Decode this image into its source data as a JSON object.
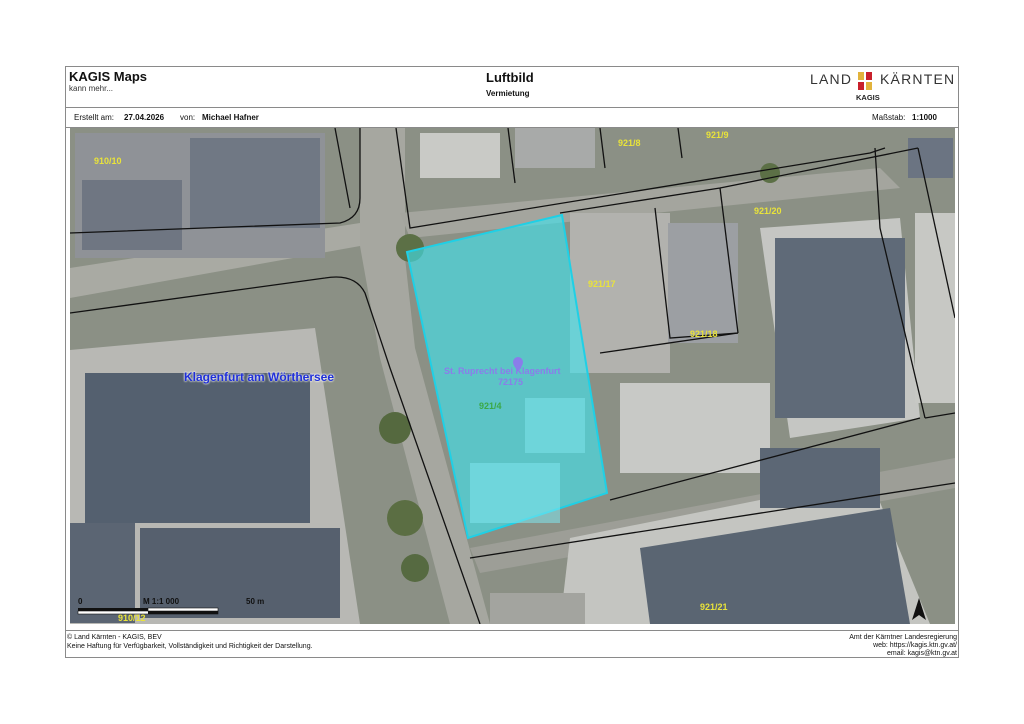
{
  "header": {
    "app_title": "KAGIS Maps",
    "app_subtitle": "kann mehr...",
    "map_title": "Luftbild",
    "map_subtitle": "Vermietung",
    "logo": {
      "word_left": "LAND",
      "word_right": "KÄRNTEN",
      "sub": "KAGIS",
      "colors": [
        "#e2b33c",
        "#c8202b"
      ]
    }
  },
  "meta": {
    "created_label": "Erstellt am:",
    "created_value": "27.04.2026",
    "author_label": "von:",
    "author_value": "Michael Hafner",
    "scale_label": "Maßstab:",
    "scale_value": "1:1000"
  },
  "map": {
    "place_label": "Klagenfurt am Wörthersee",
    "cadastral_community": "St. Ruprecht bei Klagenfurt",
    "cadastral_community_number": "72175",
    "selected_parcel": "921/4",
    "selection_color": "#3fe3ef",
    "parcels": [
      "910/10",
      "921/8",
      "921/9",
      "921/20",
      "921/17",
      "921/18",
      "921/21",
      "910/12"
    ],
    "scalebar": {
      "start": "0",
      "label": "M 1:1 000",
      "end": "50 m"
    },
    "north_arrow": "north-arrow-icon"
  },
  "footer": {
    "copyright": "© Land Kärnten - KAGIS, BEV",
    "disclaimer": "Keine Haftung für Verfügbarkeit, Vollständigkeit und Richtigkeit der Darstellung.",
    "office": "Amt der Kärntner Landesregierung",
    "web": "web: https://kagis.ktn.gv.at/",
    "email": "email: kagis@ktn.gv.at"
  }
}
